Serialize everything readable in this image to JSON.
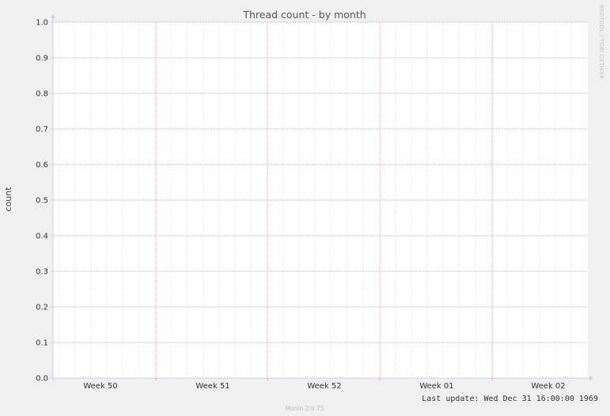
{
  "chart_data": {
    "type": "line",
    "title": "Thread count - by month",
    "ylabel": "count",
    "xlabel": "",
    "ylim": [
      0,
      1
    ],
    "y_ticks": [
      "0.0",
      "0.1",
      "0.2",
      "0.3",
      "0.4",
      "0.5",
      "0.6",
      "0.7",
      "0.8",
      "0.9",
      "1.0"
    ],
    "x_ticks": [
      "Week 50",
      "Week 51",
      "Week 52",
      "Week 01",
      "Week 02"
    ],
    "series": [],
    "grid": true,
    "legend": "none"
  },
  "watermark": "RRDTOOL / TOBI OETIKER",
  "footer": {
    "last_update": "Last update: Wed Dec 31 16:00:00 1969",
    "version": "Munin 2.0.75"
  },
  "colors": {
    "background": "#f0f0f0",
    "plot_area": "#ffffff",
    "major_grid": "#e8a0a8",
    "minor_grid": "#dcdcdc",
    "axis": "#ccccee"
  }
}
